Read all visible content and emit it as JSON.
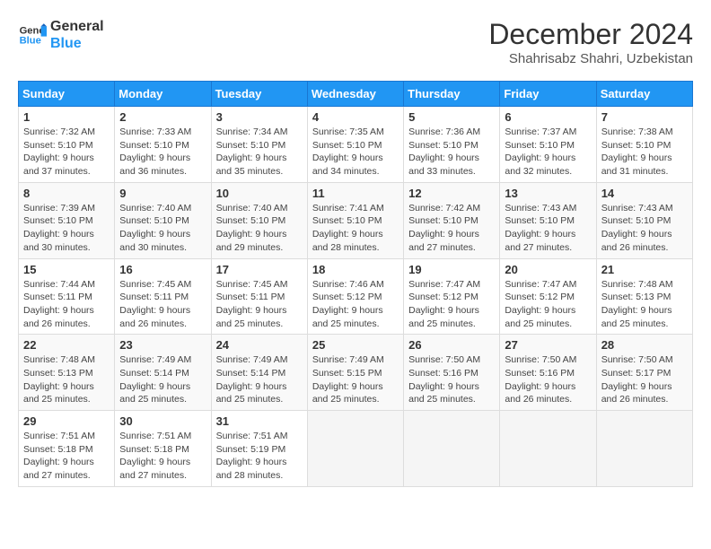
{
  "logo": {
    "line1": "General",
    "line2": "Blue"
  },
  "title": "December 2024",
  "subtitle": "Shahrisabz Shahri, Uzbekistan",
  "days_header": [
    "Sunday",
    "Monday",
    "Tuesday",
    "Wednesday",
    "Thursday",
    "Friday",
    "Saturday"
  ],
  "weeks": [
    [
      {
        "day": "1",
        "info": "Sunrise: 7:32 AM\nSunset: 5:10 PM\nDaylight: 9 hours and 37 minutes."
      },
      {
        "day": "2",
        "info": "Sunrise: 7:33 AM\nSunset: 5:10 PM\nDaylight: 9 hours and 36 minutes."
      },
      {
        "day": "3",
        "info": "Sunrise: 7:34 AM\nSunset: 5:10 PM\nDaylight: 9 hours and 35 minutes."
      },
      {
        "day": "4",
        "info": "Sunrise: 7:35 AM\nSunset: 5:10 PM\nDaylight: 9 hours and 34 minutes."
      },
      {
        "day": "5",
        "info": "Sunrise: 7:36 AM\nSunset: 5:10 PM\nDaylight: 9 hours and 33 minutes."
      },
      {
        "day": "6",
        "info": "Sunrise: 7:37 AM\nSunset: 5:10 PM\nDaylight: 9 hours and 32 minutes."
      },
      {
        "day": "7",
        "info": "Sunrise: 7:38 AM\nSunset: 5:10 PM\nDaylight: 9 hours and 31 minutes."
      }
    ],
    [
      {
        "day": "8",
        "info": "Sunrise: 7:39 AM\nSunset: 5:10 PM\nDaylight: 9 hours and 30 minutes."
      },
      {
        "day": "9",
        "info": "Sunrise: 7:40 AM\nSunset: 5:10 PM\nDaylight: 9 hours and 30 minutes."
      },
      {
        "day": "10",
        "info": "Sunrise: 7:40 AM\nSunset: 5:10 PM\nDaylight: 9 hours and 29 minutes."
      },
      {
        "day": "11",
        "info": "Sunrise: 7:41 AM\nSunset: 5:10 PM\nDaylight: 9 hours and 28 minutes."
      },
      {
        "day": "12",
        "info": "Sunrise: 7:42 AM\nSunset: 5:10 PM\nDaylight: 9 hours and 27 minutes."
      },
      {
        "day": "13",
        "info": "Sunrise: 7:43 AM\nSunset: 5:10 PM\nDaylight: 9 hours and 27 minutes."
      },
      {
        "day": "14",
        "info": "Sunrise: 7:43 AM\nSunset: 5:10 PM\nDaylight: 9 hours and 26 minutes."
      }
    ],
    [
      {
        "day": "15",
        "info": "Sunrise: 7:44 AM\nSunset: 5:11 PM\nDaylight: 9 hours and 26 minutes."
      },
      {
        "day": "16",
        "info": "Sunrise: 7:45 AM\nSunset: 5:11 PM\nDaylight: 9 hours and 26 minutes."
      },
      {
        "day": "17",
        "info": "Sunrise: 7:45 AM\nSunset: 5:11 PM\nDaylight: 9 hours and 25 minutes."
      },
      {
        "day": "18",
        "info": "Sunrise: 7:46 AM\nSunset: 5:12 PM\nDaylight: 9 hours and 25 minutes."
      },
      {
        "day": "19",
        "info": "Sunrise: 7:47 AM\nSunset: 5:12 PM\nDaylight: 9 hours and 25 minutes."
      },
      {
        "day": "20",
        "info": "Sunrise: 7:47 AM\nSunset: 5:12 PM\nDaylight: 9 hours and 25 minutes."
      },
      {
        "day": "21",
        "info": "Sunrise: 7:48 AM\nSunset: 5:13 PM\nDaylight: 9 hours and 25 minutes."
      }
    ],
    [
      {
        "day": "22",
        "info": "Sunrise: 7:48 AM\nSunset: 5:13 PM\nDaylight: 9 hours and 25 minutes."
      },
      {
        "day": "23",
        "info": "Sunrise: 7:49 AM\nSunset: 5:14 PM\nDaylight: 9 hours and 25 minutes."
      },
      {
        "day": "24",
        "info": "Sunrise: 7:49 AM\nSunset: 5:14 PM\nDaylight: 9 hours and 25 minutes."
      },
      {
        "day": "25",
        "info": "Sunrise: 7:49 AM\nSunset: 5:15 PM\nDaylight: 9 hours and 25 minutes."
      },
      {
        "day": "26",
        "info": "Sunrise: 7:50 AM\nSunset: 5:16 PM\nDaylight: 9 hours and 25 minutes."
      },
      {
        "day": "27",
        "info": "Sunrise: 7:50 AM\nSunset: 5:16 PM\nDaylight: 9 hours and 26 minutes."
      },
      {
        "day": "28",
        "info": "Sunrise: 7:50 AM\nSunset: 5:17 PM\nDaylight: 9 hours and 26 minutes."
      }
    ],
    [
      {
        "day": "29",
        "info": "Sunrise: 7:51 AM\nSunset: 5:18 PM\nDaylight: 9 hours and 27 minutes."
      },
      {
        "day": "30",
        "info": "Sunrise: 7:51 AM\nSunset: 5:18 PM\nDaylight: 9 hours and 27 minutes."
      },
      {
        "day": "31",
        "info": "Sunrise: 7:51 AM\nSunset: 5:19 PM\nDaylight: 9 hours and 28 minutes."
      },
      {
        "day": "",
        "info": ""
      },
      {
        "day": "",
        "info": ""
      },
      {
        "day": "",
        "info": ""
      },
      {
        "day": "",
        "info": ""
      }
    ]
  ]
}
